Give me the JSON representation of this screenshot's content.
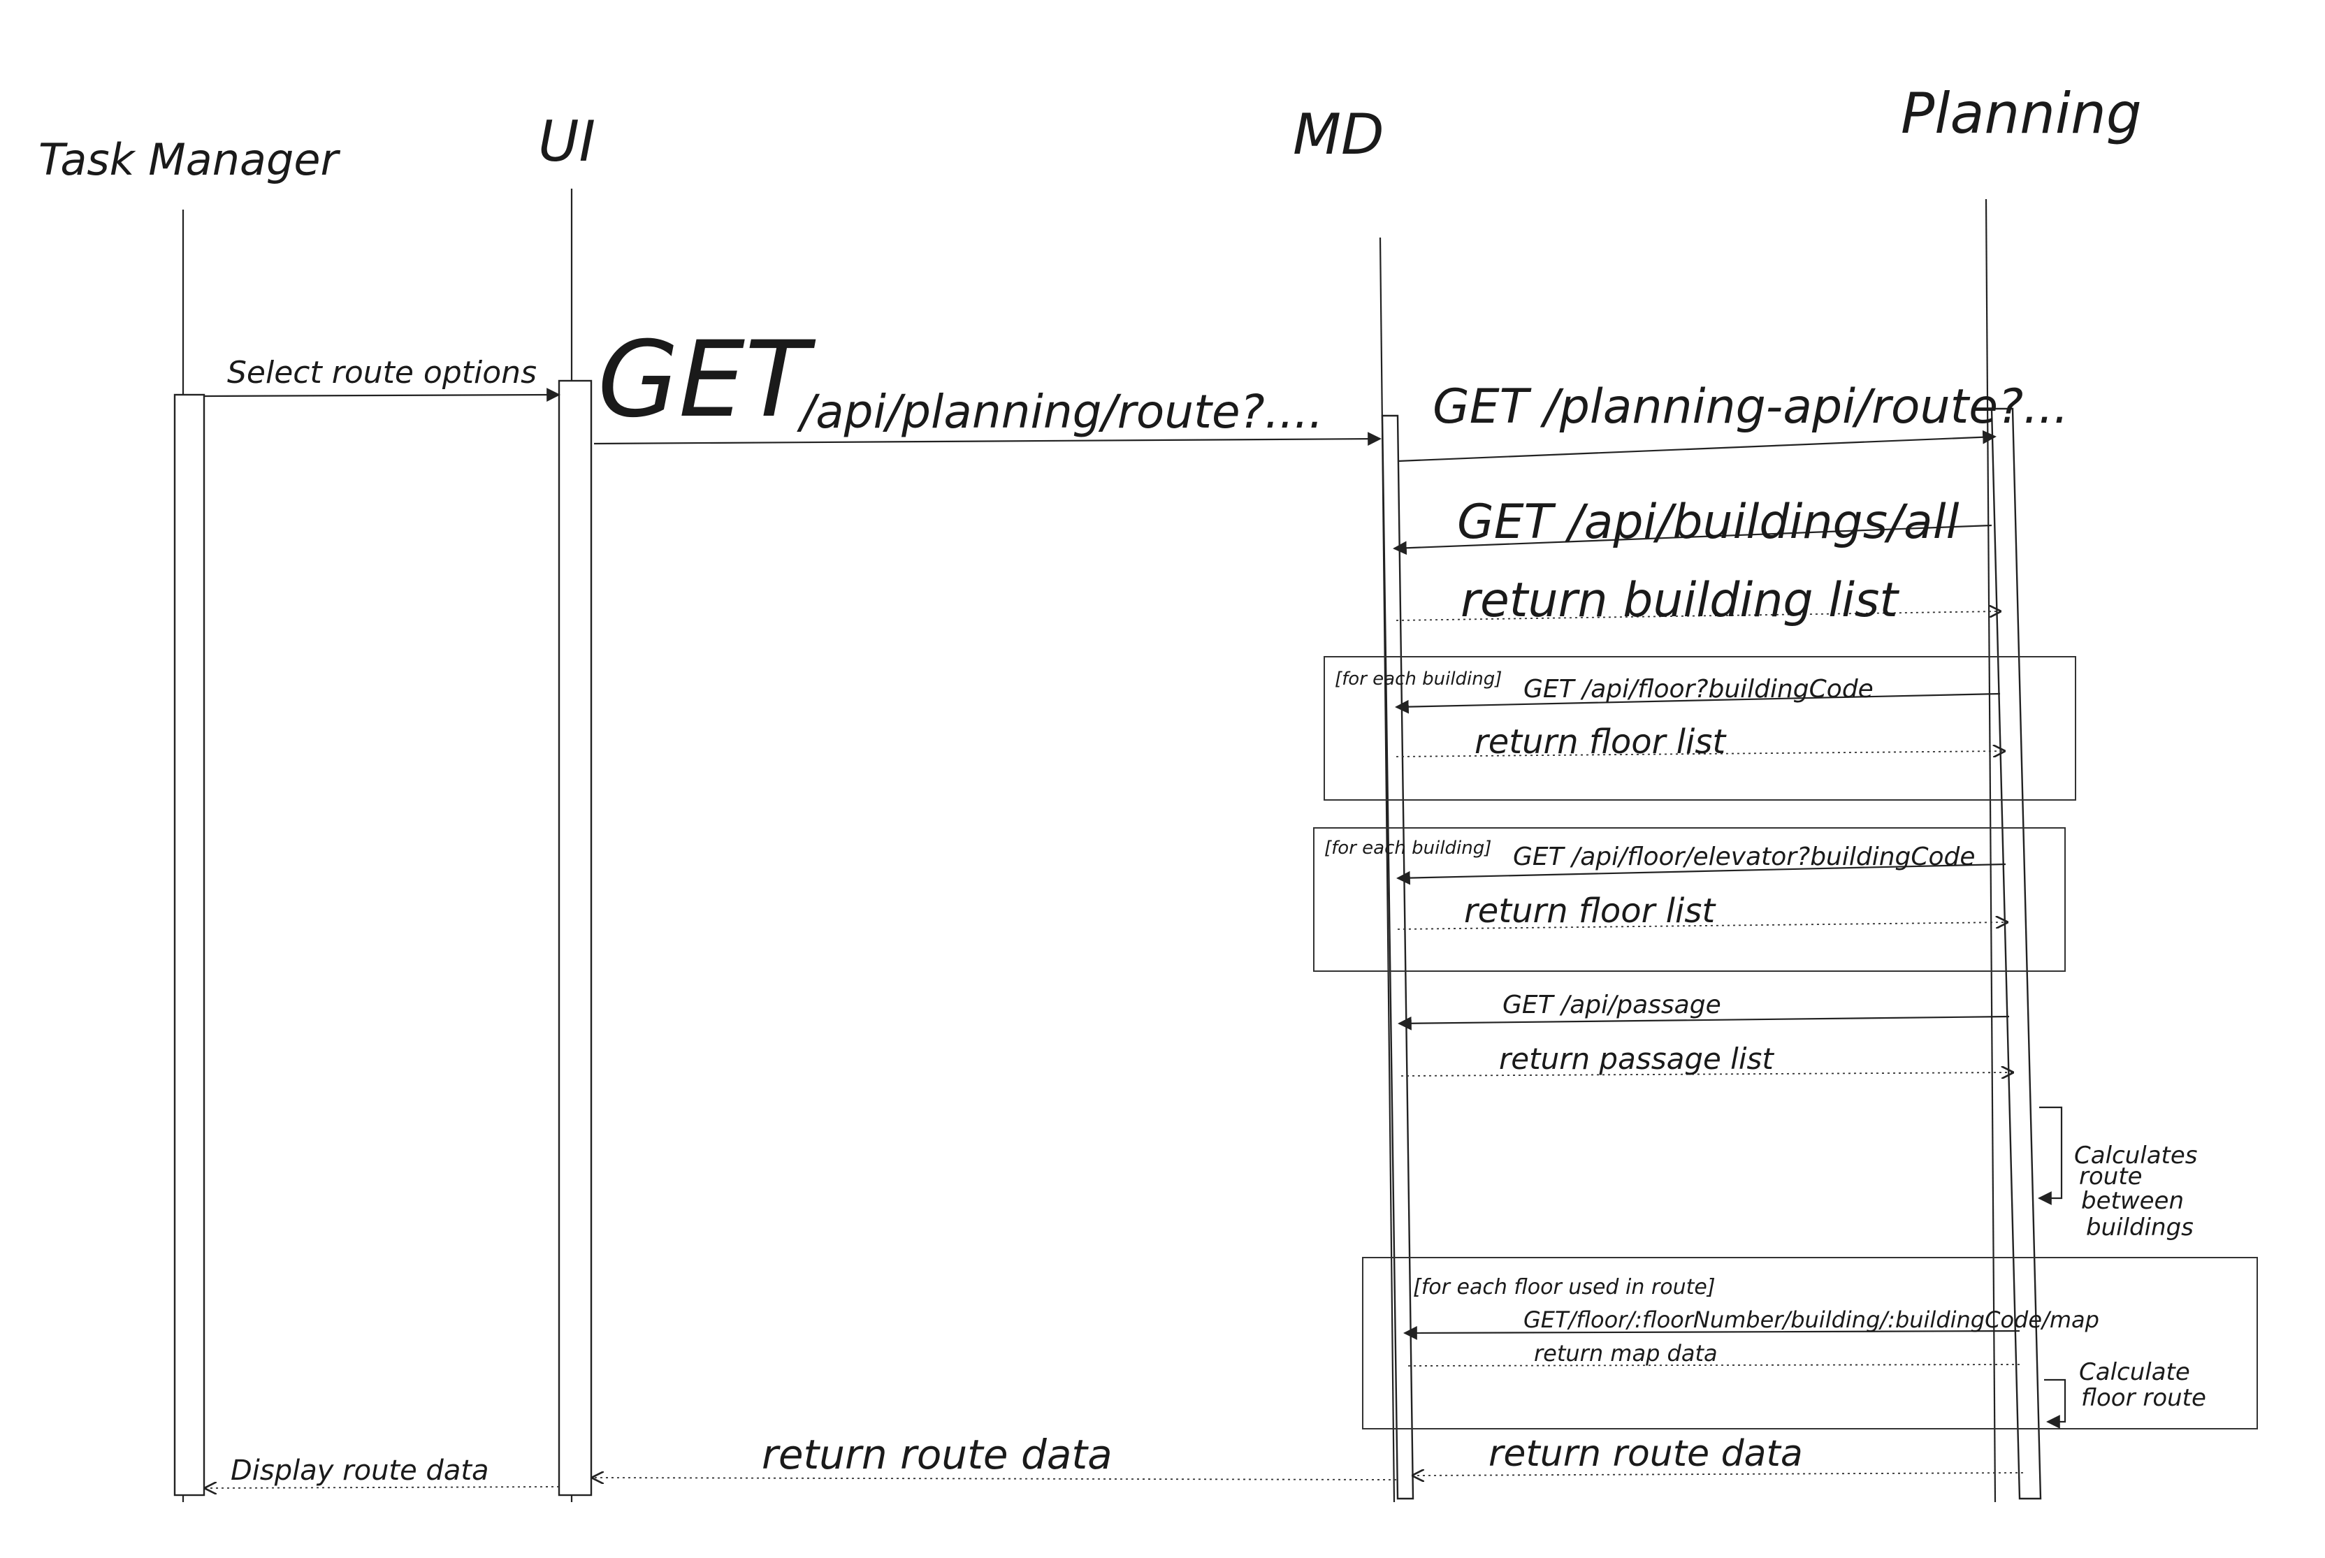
{
  "participants": {
    "task_manager": "Task Manager",
    "ui": "UI",
    "md": "MD",
    "planning": "Planning"
  },
  "messages": {
    "select_route": "Select route options",
    "get_word": "GET",
    "get_api_route": "/api/planning/route?....",
    "get_planning_route": "GET /planning-api/route?...",
    "get_buildings_all": "GET /api/buildings/all",
    "return_building_list": "return building list",
    "get_floor_by_building": "GET /api/floor?buildingCode",
    "return_floor_list_1": "return floor list",
    "get_floor_elevator": "GET /api/floor/elevator?buildingCode",
    "return_floor_list_2": "return floor list",
    "get_passage": "GET /api/passage",
    "return_passage_list": "return passage list",
    "get_floor_map": "GET/floor/:floorNumber/building/:buildingCode/map",
    "return_map_data": "return map data",
    "return_route_data_md": "return route data",
    "return_route_data_ui": "return route data",
    "display_route_data": "Display route data"
  },
  "fragments": {
    "loop_buildings_1": "[for each building]",
    "loop_buildings_2": "[for each building]",
    "loop_floors": "[for each floor used in route]"
  },
  "notes": {
    "calc_between_buildings": [
      "Calculates",
      "route",
      "between",
      "buildings"
    ],
    "calc_floor_route": [
      "Calculate",
      "floor route"
    ]
  }
}
